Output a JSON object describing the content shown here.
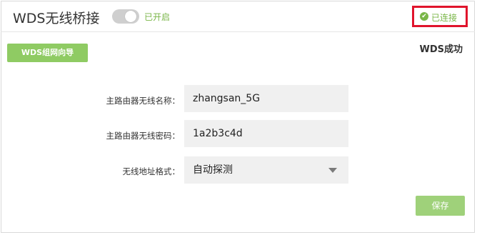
{
  "header": {
    "title": "WDS无线桥接",
    "toggle_status": "已开启",
    "connection_status": "已连接"
  },
  "toolbar": {
    "wizard_label": "WDS组网向导",
    "wds_result": "WDS成功"
  },
  "form": {
    "ssid_label": "主路由器无线名称：",
    "ssid_value": "zhangsan_5G",
    "password_label": "主路由器无线密码：",
    "password_value": "1a2b3c4d",
    "address_label": "无线地址格式：",
    "address_value": "自动探测"
  },
  "footer": {
    "save_label": "保存"
  },
  "colors": {
    "accent_green": "#7ab648",
    "button_green": "#8fcb63",
    "highlight_red": "#e0142c"
  },
  "icons": {
    "connection": "check-circle-icon",
    "select": "chevron-down-icon"
  }
}
